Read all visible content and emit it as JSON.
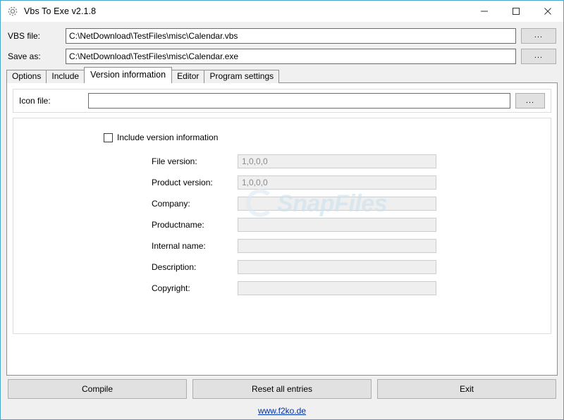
{
  "window": {
    "title": "Vbs To Exe v2.1.8",
    "icon": "gear-icon",
    "controls": {
      "minimize": "minimize-icon",
      "maximize": "maximize-icon",
      "close": "close-icon"
    },
    "accent_border_color": "#4ba3c7"
  },
  "top_fields": [
    {
      "label": "VBS file:",
      "value": "C:\\NetDownload\\TestFiles\\misc\\Calendar.vbs",
      "placeholder": "",
      "browse_label": "..."
    },
    {
      "label": "Save as:",
      "value": "C:\\NetDownload\\TestFiles\\misc\\Calendar.exe",
      "placeholder": "",
      "browse_label": "..."
    }
  ],
  "tabs": [
    {
      "label": "Options",
      "active": false
    },
    {
      "label": "Include",
      "active": false
    },
    {
      "label": "Version information",
      "active": true
    },
    {
      "label": "Editor",
      "active": false
    },
    {
      "label": "Program settings",
      "active": false
    }
  ],
  "version_tab": {
    "icon_file": {
      "label": "Icon file:",
      "value": "",
      "placeholder": "",
      "browse_label": "..."
    },
    "include_version_checkbox": {
      "label": "Include version information",
      "checked": false
    },
    "fields": [
      {
        "label": "File version:",
        "value": "1,0,0,0",
        "placeholder": ""
      },
      {
        "label": "Product version:",
        "value": "1,0,0,0",
        "placeholder": ""
      },
      {
        "label": "Company:",
        "value": "",
        "placeholder": ""
      },
      {
        "label": "Productname:",
        "value": "",
        "placeholder": ""
      },
      {
        "label": "Internal name:",
        "value": "",
        "placeholder": ""
      },
      {
        "label": "Description:",
        "value": "",
        "placeholder": ""
      },
      {
        "label": "Copyright:",
        "value": "",
        "placeholder": ""
      }
    ],
    "watermark": "SnapFiles"
  },
  "bottom_buttons": [
    {
      "label": "Compile"
    },
    {
      "label": "Reset all entries"
    },
    {
      "label": "Exit"
    }
  ],
  "footer": {
    "link_text": "www.f2ko.de"
  }
}
